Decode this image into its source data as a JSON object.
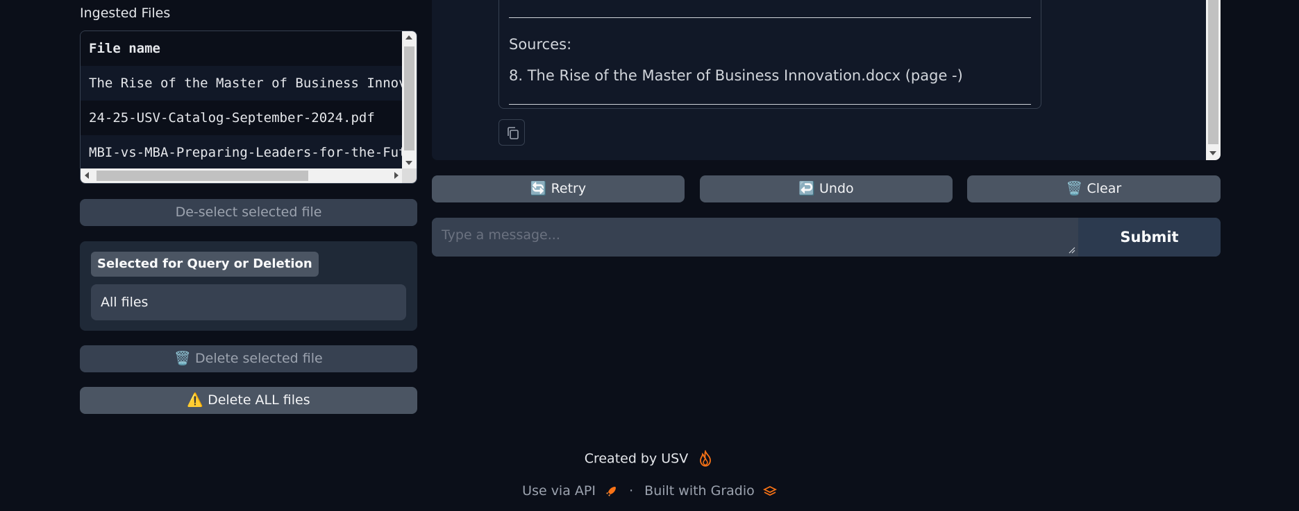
{
  "sidebar": {
    "ingested_label": "Ingested Files",
    "table": {
      "header": "File name",
      "rows": [
        "The Rise of the Master of Business Innovation.docx",
        "24-25-USV-Catalog-September-2024.pdf",
        "MBI-vs-MBA-Preparing-Leaders-for-the-Future.pdf"
      ]
    },
    "deselect_label": "De-select selected file",
    "selected_panel": {
      "label": "Selected for Query or Deletion",
      "value": "All files"
    },
    "delete_selected_label": "🗑️ Delete selected file",
    "delete_all_label": "⚠️ Delete ALL files"
  },
  "chat": {
    "sources_label": "Sources:",
    "source_item": "8. The Rise of the Master of Business Innovation.docx (page -)",
    "buttons": {
      "retry": "🔄 Retry",
      "undo": "↩️ Undo",
      "clear": "🗑️ Clear"
    },
    "input_placeholder": "Type a message...",
    "submit_label": "Submit"
  },
  "footer": {
    "created_by": "Created by USV",
    "use_api": "Use via API",
    "separator": "·",
    "built_with": "Built with Gradio"
  },
  "icons": {
    "flame": "flame-icon",
    "rocket": "rocket-icon",
    "gradio_logo": "gradio-logo-icon",
    "copy": "copy-icon"
  },
  "colors": {
    "background": "#0b0f19",
    "panel": "#1f2937",
    "button": "#4b5563",
    "submit": "#2c3a4f",
    "accent_orange": "#f97316"
  }
}
